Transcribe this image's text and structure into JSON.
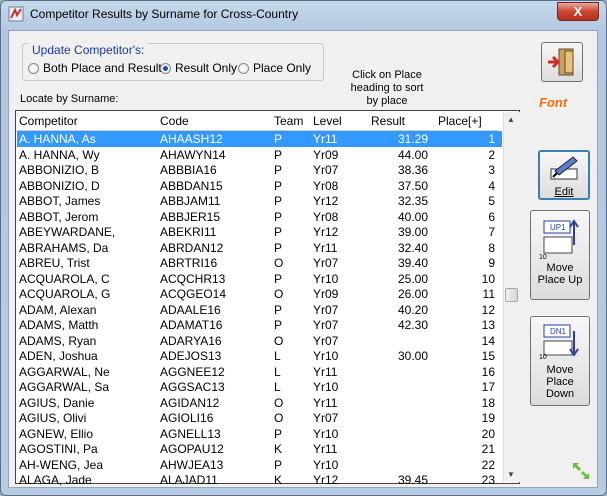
{
  "window": {
    "title": "Competitor Results by Surname for Cross-Country",
    "close_label": "X"
  },
  "update_group": {
    "label": "Update Competitor's:",
    "options": [
      {
        "label": "Both Place and Result",
        "selected": false
      },
      {
        "label": "Result Only",
        "selected": true
      },
      {
        "label": "Place Only",
        "selected": false
      }
    ]
  },
  "hint": {
    "line1": "Click on Place",
    "line2": "heading to sort",
    "line3": "by place"
  },
  "locate_label": "Locate by Surname:",
  "table": {
    "columns": [
      "Competitor",
      "Code",
      "Team",
      "Level",
      "Result",
      "Place[+]"
    ],
    "rows": [
      [
        "A. HANNA, As",
        "AHAASH12",
        "P",
        "Yr11",
        "31.29",
        "1"
      ],
      [
        "A. HANNA, Wy",
        "AHAWYN14",
        "P",
        "Yr09",
        "44.00",
        "2"
      ],
      [
        "ABBONIZIO, B",
        "ABBBIA16",
        "P",
        "Yr07",
        "38.36",
        "3"
      ],
      [
        "ABBONIZIO, D",
        "ABBDAN15",
        "P",
        "Yr08",
        "37.50",
        "4"
      ],
      [
        "ABBOT, James",
        "ABBJAM11",
        "P",
        "Yr12",
        "32.35",
        "5"
      ],
      [
        "ABBOT, Jerom",
        "ABBJER15",
        "P",
        "Yr08",
        "40.00",
        "6"
      ],
      [
        "ABEYWARDANE,",
        "ABEKRI11",
        "P",
        "Yr12",
        "39.00",
        "7"
      ],
      [
        "ABRAHAMS, Da",
        "ABRDAN12",
        "P",
        "Yr11",
        "32.40",
        "8"
      ],
      [
        "ABREU, Trist",
        "ABRTRI16",
        "O",
        "Yr07",
        "39.40",
        "9"
      ],
      [
        "ACQUAROLA, C",
        "ACQCHR13",
        "P",
        "Yr10",
        "25.00",
        "10"
      ],
      [
        "ACQUAROLA, G",
        "ACQGEO14",
        "O",
        "Yr09",
        "26.00",
        "11"
      ],
      [
        "ADAM, Alexan",
        "ADAALE16",
        "P",
        "Yr07",
        "40.20",
        "12"
      ],
      [
        "ADAMS, Matth",
        "ADAMAT16",
        "P",
        "Yr07",
        "42.30",
        "13"
      ],
      [
        "ADAMS, Ryan",
        "ADARYA16",
        "O",
        "Yr07",
        "",
        "14"
      ],
      [
        "ADEN, Joshua",
        "ADEJOS13",
        "L",
        "Yr10",
        "30.00",
        "15"
      ],
      [
        "AGGARWAL, Ne",
        "AGGNEE12",
        "L",
        "Yr11",
        "",
        "16"
      ],
      [
        "AGGARWAL, Sa",
        "AGGSAC13",
        "L",
        "Yr10",
        "",
        "17"
      ],
      [
        "AGIUS, Danie",
        "AGIDAN12",
        "O",
        "Yr11",
        "",
        "18"
      ],
      [
        "AGIUS, Olivi",
        "AGIOLI16",
        "O",
        "Yr07",
        "",
        "19"
      ],
      [
        "AGNEW, Ellio",
        "AGNELL13",
        "P",
        "Yr10",
        "",
        "20"
      ],
      [
        "AGOSTINI, Pa",
        "AGOPAU12",
        "K",
        "Yr11",
        "",
        "21"
      ],
      [
        "AH-WENG, Jea",
        "AHWJEA13",
        "P",
        "Yr10",
        "",
        "22"
      ],
      [
        "ALAGA, Jade",
        "ALAJAD11",
        "K",
        "Yr12",
        "39.45",
        "23"
      ]
    ]
  },
  "side": {
    "font_label": "Font",
    "edit_label": "Edit",
    "up_label1": "Move",
    "up_label2": "Place Up",
    "up_tag": "UP1",
    "down_label1": "Move",
    "down_label2": "Place",
    "down_label3": "Down",
    "down_tag": "DN1",
    "doc_number": "10"
  },
  "colors": {
    "selection": "#3399ff",
    "group_label": "#1c3a9a",
    "font_label": "#ff6a00"
  }
}
